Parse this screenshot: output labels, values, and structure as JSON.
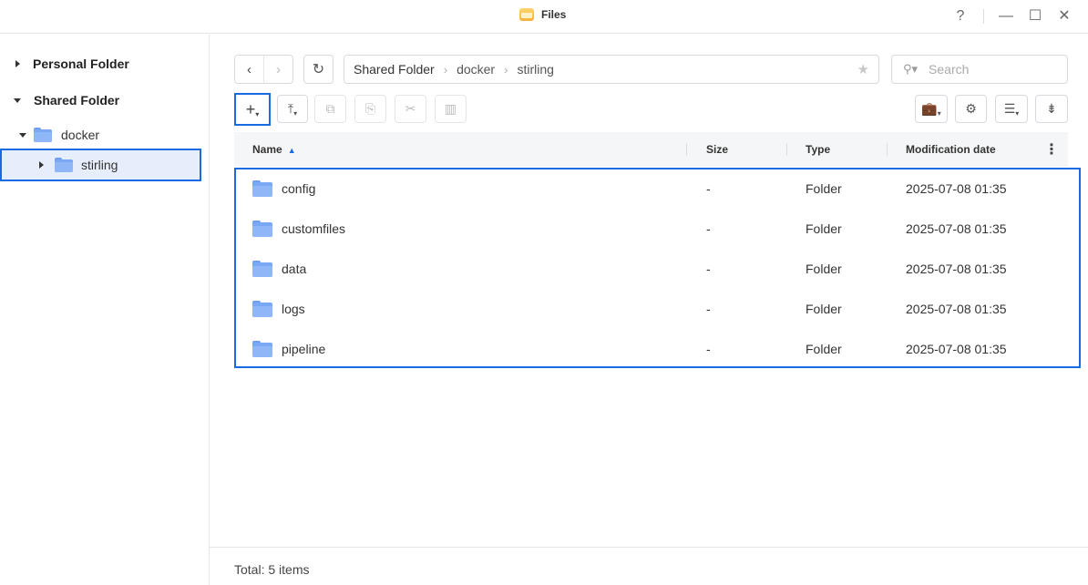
{
  "window": {
    "title": "Files",
    "controls": {
      "help": "?",
      "minimize": "—",
      "maximize": "☐",
      "close": "✕"
    }
  },
  "sidebar": {
    "personal_folder": "Personal Folder",
    "shared_folder": "Shared Folder",
    "docker": "docker",
    "stirling": "stirling"
  },
  "toolbar": {
    "back": "‹",
    "forward": "›",
    "refresh": "↻",
    "breadcrumb": [
      "Shared Folder",
      "docker",
      "stirling"
    ],
    "search_placeholder": "Search"
  },
  "table": {
    "headers": {
      "name": "Name",
      "size": "Size",
      "type": "Type",
      "modified": "Modification date"
    },
    "rows": [
      {
        "name": "config",
        "size": "-",
        "type": "Folder",
        "modified": "2025-07-08 01:35"
      },
      {
        "name": "customfiles",
        "size": "-",
        "type": "Folder",
        "modified": "2025-07-08 01:35"
      },
      {
        "name": "data",
        "size": "-",
        "type": "Folder",
        "modified": "2025-07-08 01:35"
      },
      {
        "name": "logs",
        "size": "-",
        "type": "Folder",
        "modified": "2025-07-08 01:35"
      },
      {
        "name": "pipeline",
        "size": "-",
        "type": "Folder",
        "modified": "2025-07-08 01:35"
      }
    ]
  },
  "footer": {
    "total": "Total: 5 items"
  },
  "colors": {
    "accent": "#1a6be3",
    "folder": "#7aa8f4"
  }
}
